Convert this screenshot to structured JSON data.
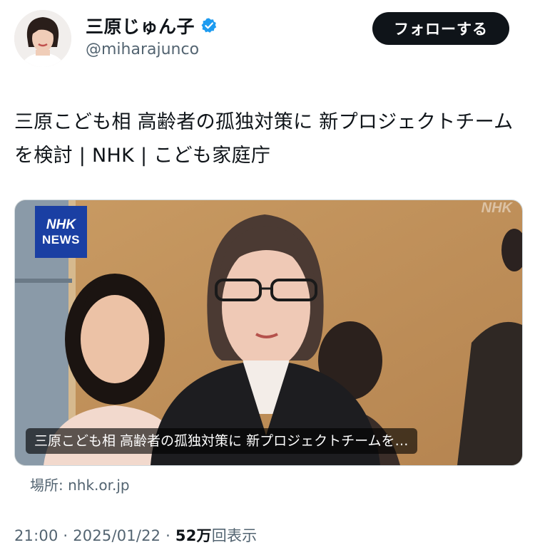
{
  "author": {
    "display_name": "三原じゅん子",
    "handle": "@miharajunco",
    "verified_icon": "verified-badge-icon",
    "verified_color": "#1d9bf0"
  },
  "follow_button": {
    "label": "フォローする"
  },
  "tweet": {
    "text": "三原こども相 高齢者の孤独対策に 新プロジェクトチームを検討 | NHK | こども家庭庁"
  },
  "card": {
    "logo_line1": "NHK",
    "logo_line2": "NEWS",
    "watermark": "NHK",
    "caption": "三原こども相 高齢者の孤独対策に 新プロジェクトチームを…",
    "source": "場所: nhk.or.jp"
  },
  "meta": {
    "time": "21:00",
    "separator": "·",
    "date": "2025/01/22",
    "views_count": "52万",
    "views_label": "回表示"
  },
  "colors": {
    "text": "#0f1419",
    "secondary": "#536471",
    "button_bg": "#0f1419",
    "nhk_blue": "#1a3fa3"
  }
}
